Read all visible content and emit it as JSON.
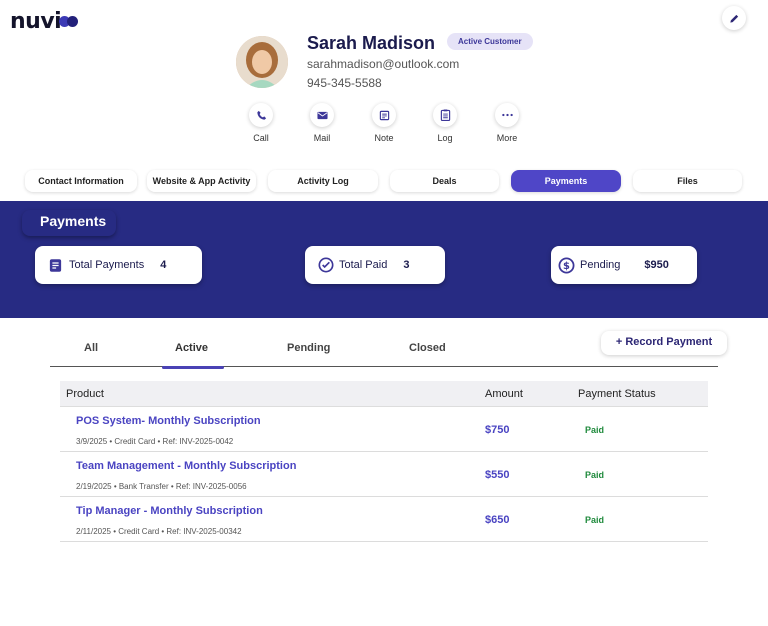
{
  "brand": {
    "logo_text": "nuvi"
  },
  "profile": {
    "name": "Sarah Madison",
    "badge": "Active Customer",
    "email": "sarahmadison@outlook.com",
    "phone": "945-345-5588"
  },
  "actions": [
    {
      "label": "Call",
      "icon": "phone-icon"
    },
    {
      "label": "Mail",
      "icon": "mail-icon"
    },
    {
      "label": "Note",
      "icon": "note-icon"
    },
    {
      "label": "Log",
      "icon": "clipboard-icon"
    },
    {
      "label": "More",
      "icon": "more-icon"
    }
  ],
  "tabs": [
    {
      "label": "Contact Information"
    },
    {
      "label": "Website & App Activity"
    },
    {
      "label": "Activity Log"
    },
    {
      "label": "Deals"
    },
    {
      "label": "Payments",
      "active": true
    },
    {
      "label": "Files"
    }
  ],
  "payments": {
    "title": "Payments",
    "stats": [
      {
        "label": "Total Payments",
        "value": "4",
        "icon": "receipt-icon"
      },
      {
        "label": "Total Paid",
        "value": "3",
        "icon": "check-circle-icon"
      },
      {
        "label": "Pending",
        "value": "$950",
        "icon": "dollar-icon"
      }
    ]
  },
  "filters": {
    "tabs": [
      {
        "label": "All"
      },
      {
        "label": "Active",
        "active": true
      },
      {
        "label": "Pending"
      },
      {
        "label": "Closed"
      }
    ],
    "record_button": "+ Record Payment"
  },
  "table": {
    "headers": {
      "product": "Product",
      "amount": "Amount",
      "status": "Payment Status"
    },
    "rows": [
      {
        "product": "POS System- Monthly Subscription",
        "meta": "3/9/2025 • Credit Card • Ref: INV-2025-0042",
        "amount": "$750",
        "status": "Paid"
      },
      {
        "product": "Team Management -  Monthly Subscription",
        "meta": "2/19/2025 • Bank Transfer • Ref: INV-2025-0056",
        "amount": "$550",
        "status": "Paid"
      },
      {
        "product": "Tip Manager -  Monthly Subscription",
        "meta": "2/11/2025 • Credit Card • Ref: INV-2025-00342",
        "amount": "$650",
        "status": "Paid"
      }
    ]
  },
  "colors": {
    "accent": "#4f46c7",
    "band": "#272b83",
    "paid": "#1f8a3c"
  }
}
